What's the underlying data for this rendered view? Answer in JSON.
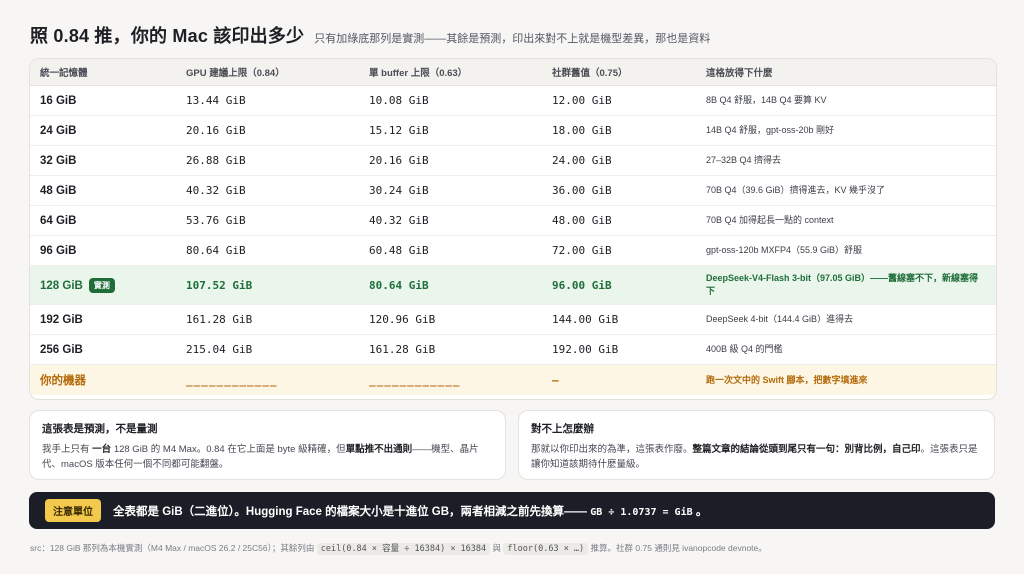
{
  "header": {
    "title": "照 0.84 推，你的 Mac 該印出多少",
    "subtitle": "只有加綠底那列是實測——其餘是預測，印出來對不上就是機型差異，那也是資料"
  },
  "table": {
    "headers": [
      "統一記憶體",
      "GPU 建議上限（0.84）",
      "單 buffer 上限（0.63）",
      "社群舊值（0.75）",
      "這格放得下什麼"
    ],
    "rows": [
      {
        "mem": "16 GiB",
        "gpu": "13.44 GiB",
        "buf": "10.08 GiB",
        "old": "12.00 GiB",
        "note": "8B Q4 舒服，14B Q4 要算 KV"
      },
      {
        "mem": "24 GiB",
        "gpu": "20.16 GiB",
        "buf": "15.12 GiB",
        "old": "18.00 GiB",
        "note": "14B Q4 舒服，gpt-oss-20b 剛好"
      },
      {
        "mem": "32 GiB",
        "gpu": "26.88 GiB",
        "buf": "20.16 GiB",
        "old": "24.00 GiB",
        "note": "27–32B Q4 擠得去"
      },
      {
        "mem": "48 GiB",
        "gpu": "40.32 GiB",
        "buf": "30.24 GiB",
        "old": "36.00 GiB",
        "note": "70B Q4（39.6 GiB）擠得進去，KV 幾乎沒了"
      },
      {
        "mem": "64 GiB",
        "gpu": "53.76 GiB",
        "buf": "40.32 GiB",
        "old": "48.00 GiB",
        "note": "70B Q4 加得起長一點的 context"
      },
      {
        "mem": "96 GiB",
        "gpu": "80.64 GiB",
        "buf": "60.48 GiB",
        "old": "72.00 GiB",
        "note": "gpt-oss-120b MXFP4（55.9 GiB）舒服"
      }
    ],
    "tested": {
      "mem": "128 GiB",
      "badge": "實測",
      "gpu": "107.52 GiB",
      "buf": "80.64 GiB",
      "old": "96.00 GiB",
      "note": "DeepSeek-V4-Flash 3-bit（97.05 GiB）——舊線塞不下，新線塞得下"
    },
    "rows2": [
      {
        "mem": "192 GiB",
        "gpu": "161.28 GiB",
        "buf": "120.96 GiB",
        "old": "144.00 GiB",
        "note": "DeepSeek 4-bit（144.4 GiB）進得去"
      },
      {
        "mem": "256 GiB",
        "gpu": "215.04 GiB",
        "buf": "161.28 GiB",
        "old": "192.00 GiB",
        "note": "400B 級 Q4 的門檻"
      }
    ],
    "mine": {
      "mem": "你的機器",
      "gpu": "____________",
      "buf": "____________",
      "old": "—",
      "note": "跑一次文中的 Swift 腳本，把數字填進來"
    }
  },
  "box_left": {
    "title": "這張表是預測，不是量測",
    "p1": "我手上只有",
    "b1": "一台",
    "p2": "128 GiB 的 M4 Max。0.84 在它上面是 byte 級精確，但",
    "b2": "單點推不出通則",
    "p3": "——機型、晶片代、macOS 版本任何一個不同都可能翻盤。"
  },
  "box_right": {
    "title": "對不上怎麼辦",
    "p1": "那就以你印出來的為準，這張表作廢。",
    "b1": "整篇文章的結論從頭到尾只有一句：別背比例，自己印",
    "p2": "。這張表只是讓你知道該期待什麼量級。"
  },
  "banner": {
    "tag": "注意單位",
    "text": "全表都是 GiB（二進位）。Hugging Face 的檔案大小是十進位 GB，兩者相減之前先換算——",
    "code": "GB ÷ 1.0737 = GiB",
    "end": "。"
  },
  "footer": {
    "t1": "src：128 GiB 那列為本機實測（M4 Max / macOS 26.2 / 25C56）；其餘列由",
    "c1": "ceil(0.84 × 容量 ÷ 16384) × 16384",
    "t2": "與",
    "c2": "floor(0.63 × …)",
    "t3": "推算。社群 0.75 通則見 ivanopcode devnote。"
  },
  "colors": {
    "accent_green": "#1f6e3a",
    "tested_bg": "#eaf5ec",
    "mine_color": "#b46a0a",
    "banner_bg": "#1b1e26",
    "tag_bg": "#f2c94c"
  }
}
